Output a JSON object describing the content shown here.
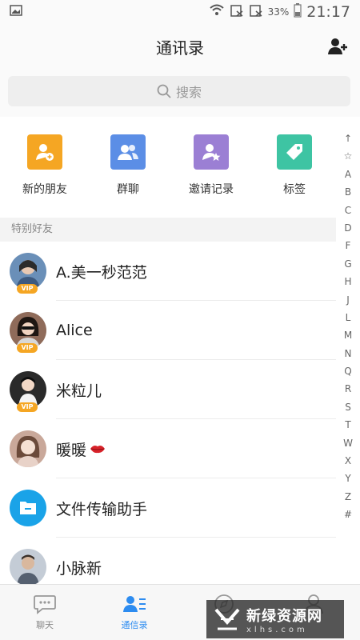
{
  "status_bar": {
    "battery_percent": "33%",
    "time": "21:17"
  },
  "header": {
    "title": "通讯录"
  },
  "search": {
    "placeholder": "搜索"
  },
  "quick_actions": [
    {
      "label": "新的朋友",
      "icon": "add-friend-icon",
      "color": "#f5a623"
    },
    {
      "label": "群聊",
      "icon": "group-icon",
      "color": "#5b8ee6"
    },
    {
      "label": "邀请记录",
      "icon": "invite-star-icon",
      "color": "#9b7fd4"
    },
    {
      "label": "标签",
      "icon": "tag-icon",
      "color": "#3ec4a3"
    }
  ],
  "section": {
    "title": "特别好友"
  },
  "contacts": [
    {
      "name": "A.美一秒范范",
      "vip": "VIP",
      "avatar_color": "#6a8fb8"
    },
    {
      "name": "Alice",
      "vip": "VIP",
      "avatar_color": "#8f6b5a"
    },
    {
      "name": "米粒儿",
      "vip": "VIP",
      "avatar_color": "#2a2a2a"
    },
    {
      "name": "暖暖",
      "vip": "",
      "avatar_color": "#c9a89a",
      "emoji": "lips-icon"
    },
    {
      "name": "文件传输助手",
      "vip": "",
      "avatar_color": "#1aa3e8",
      "icon": "folder-icon"
    },
    {
      "name": "小脉新",
      "vip": "",
      "avatar_color": "#9aa6b5"
    }
  ],
  "alphabet_index": [
    "↑",
    "☆",
    "A",
    "B",
    "C",
    "D",
    "F",
    "G",
    "H",
    "J",
    "L",
    "M",
    "N",
    "Q",
    "R",
    "S",
    "T",
    "W",
    "X",
    "Y",
    "Z",
    "#"
  ],
  "tabs": [
    {
      "label": "聊天",
      "icon": "chat-bubble-icon",
      "active": false
    },
    {
      "label": "通信录",
      "icon": "contacts-icon",
      "active": true
    },
    {
      "label": "",
      "icon": "discover-icon",
      "active": false
    },
    {
      "label": "",
      "icon": "profile-icon",
      "active": false
    }
  ],
  "watermark": {
    "title": "新绿资源网",
    "url": "xlhs.com"
  },
  "colors": {
    "accent": "#2d8cf0",
    "vip": "#f5a623"
  }
}
